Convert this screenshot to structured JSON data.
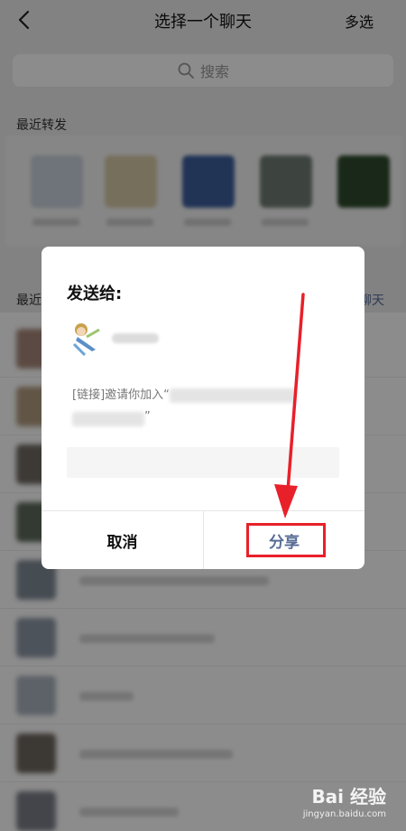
{
  "nav": {
    "title": "选择一个聊天",
    "multi_select": "多选"
  },
  "search": {
    "placeholder": "搜索"
  },
  "sections": {
    "recent_forward": "最近转发",
    "recent_chat": "最近",
    "create_chat": "聊天"
  },
  "dialog": {
    "title": "发送给:",
    "message_prefix": "[链接]邀请你加入“",
    "message_suffix": "”",
    "cancel": "取消",
    "share": "分享"
  },
  "watermark": {
    "brand": "Bai 经验",
    "site": "jingyan.baidu.com"
  },
  "colors": {
    "accent": "#576b95",
    "annotation": "#e8202a",
    "overlay": "rgba(0,0,0,0.45)"
  }
}
